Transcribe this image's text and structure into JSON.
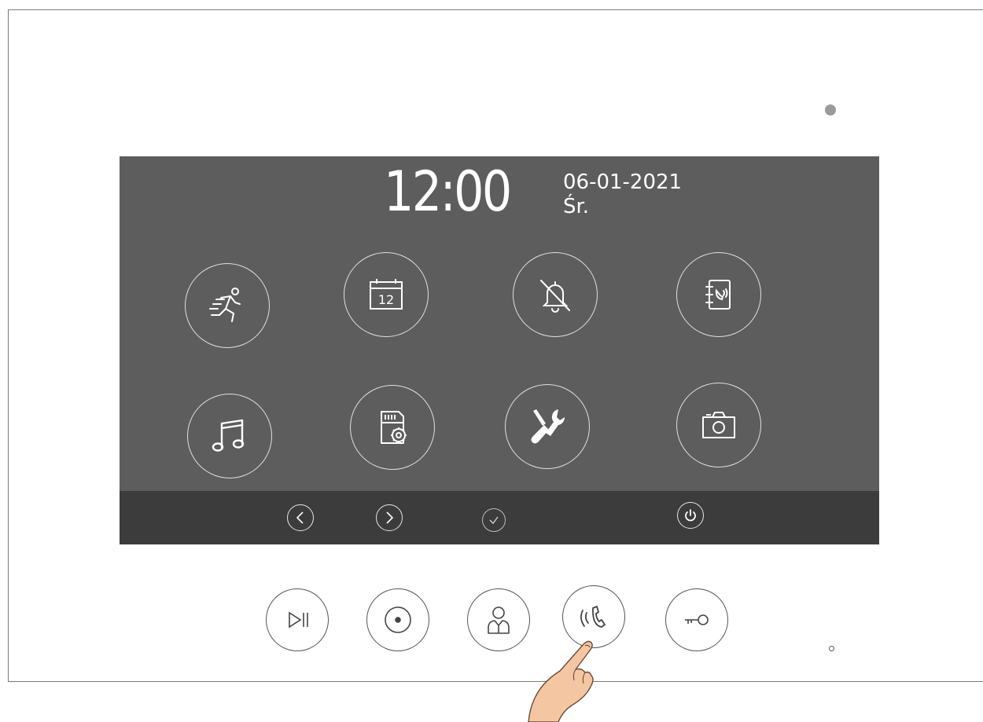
{
  "status": {
    "time": "12:00",
    "date": "06-01-2021",
    "weekday": "Śr."
  },
  "menu_icons": [
    "motion-detection-icon",
    "calendar-icon",
    "do-not-disturb-icon",
    "phonebook-icon",
    "ringtone-icon",
    "memory-card-settings-icon",
    "tools-settings-icon",
    "camera-icon"
  ],
  "calendar_day": "12",
  "nav_icons": [
    "left-arrow-icon",
    "right-arrow-icon",
    "confirm-icon",
    "power-icon"
  ],
  "hardware_buttons": [
    "play-pause-icon",
    "monitor-icon",
    "intercom-icon",
    "call-answer-icon",
    "unlock-key-icon"
  ],
  "colors": {
    "screen": "#5d5d5d",
    "bottom_bar": "#3c3c3c",
    "icon_stroke": "#ffffff",
    "bezel": "#7a7a7a"
  }
}
